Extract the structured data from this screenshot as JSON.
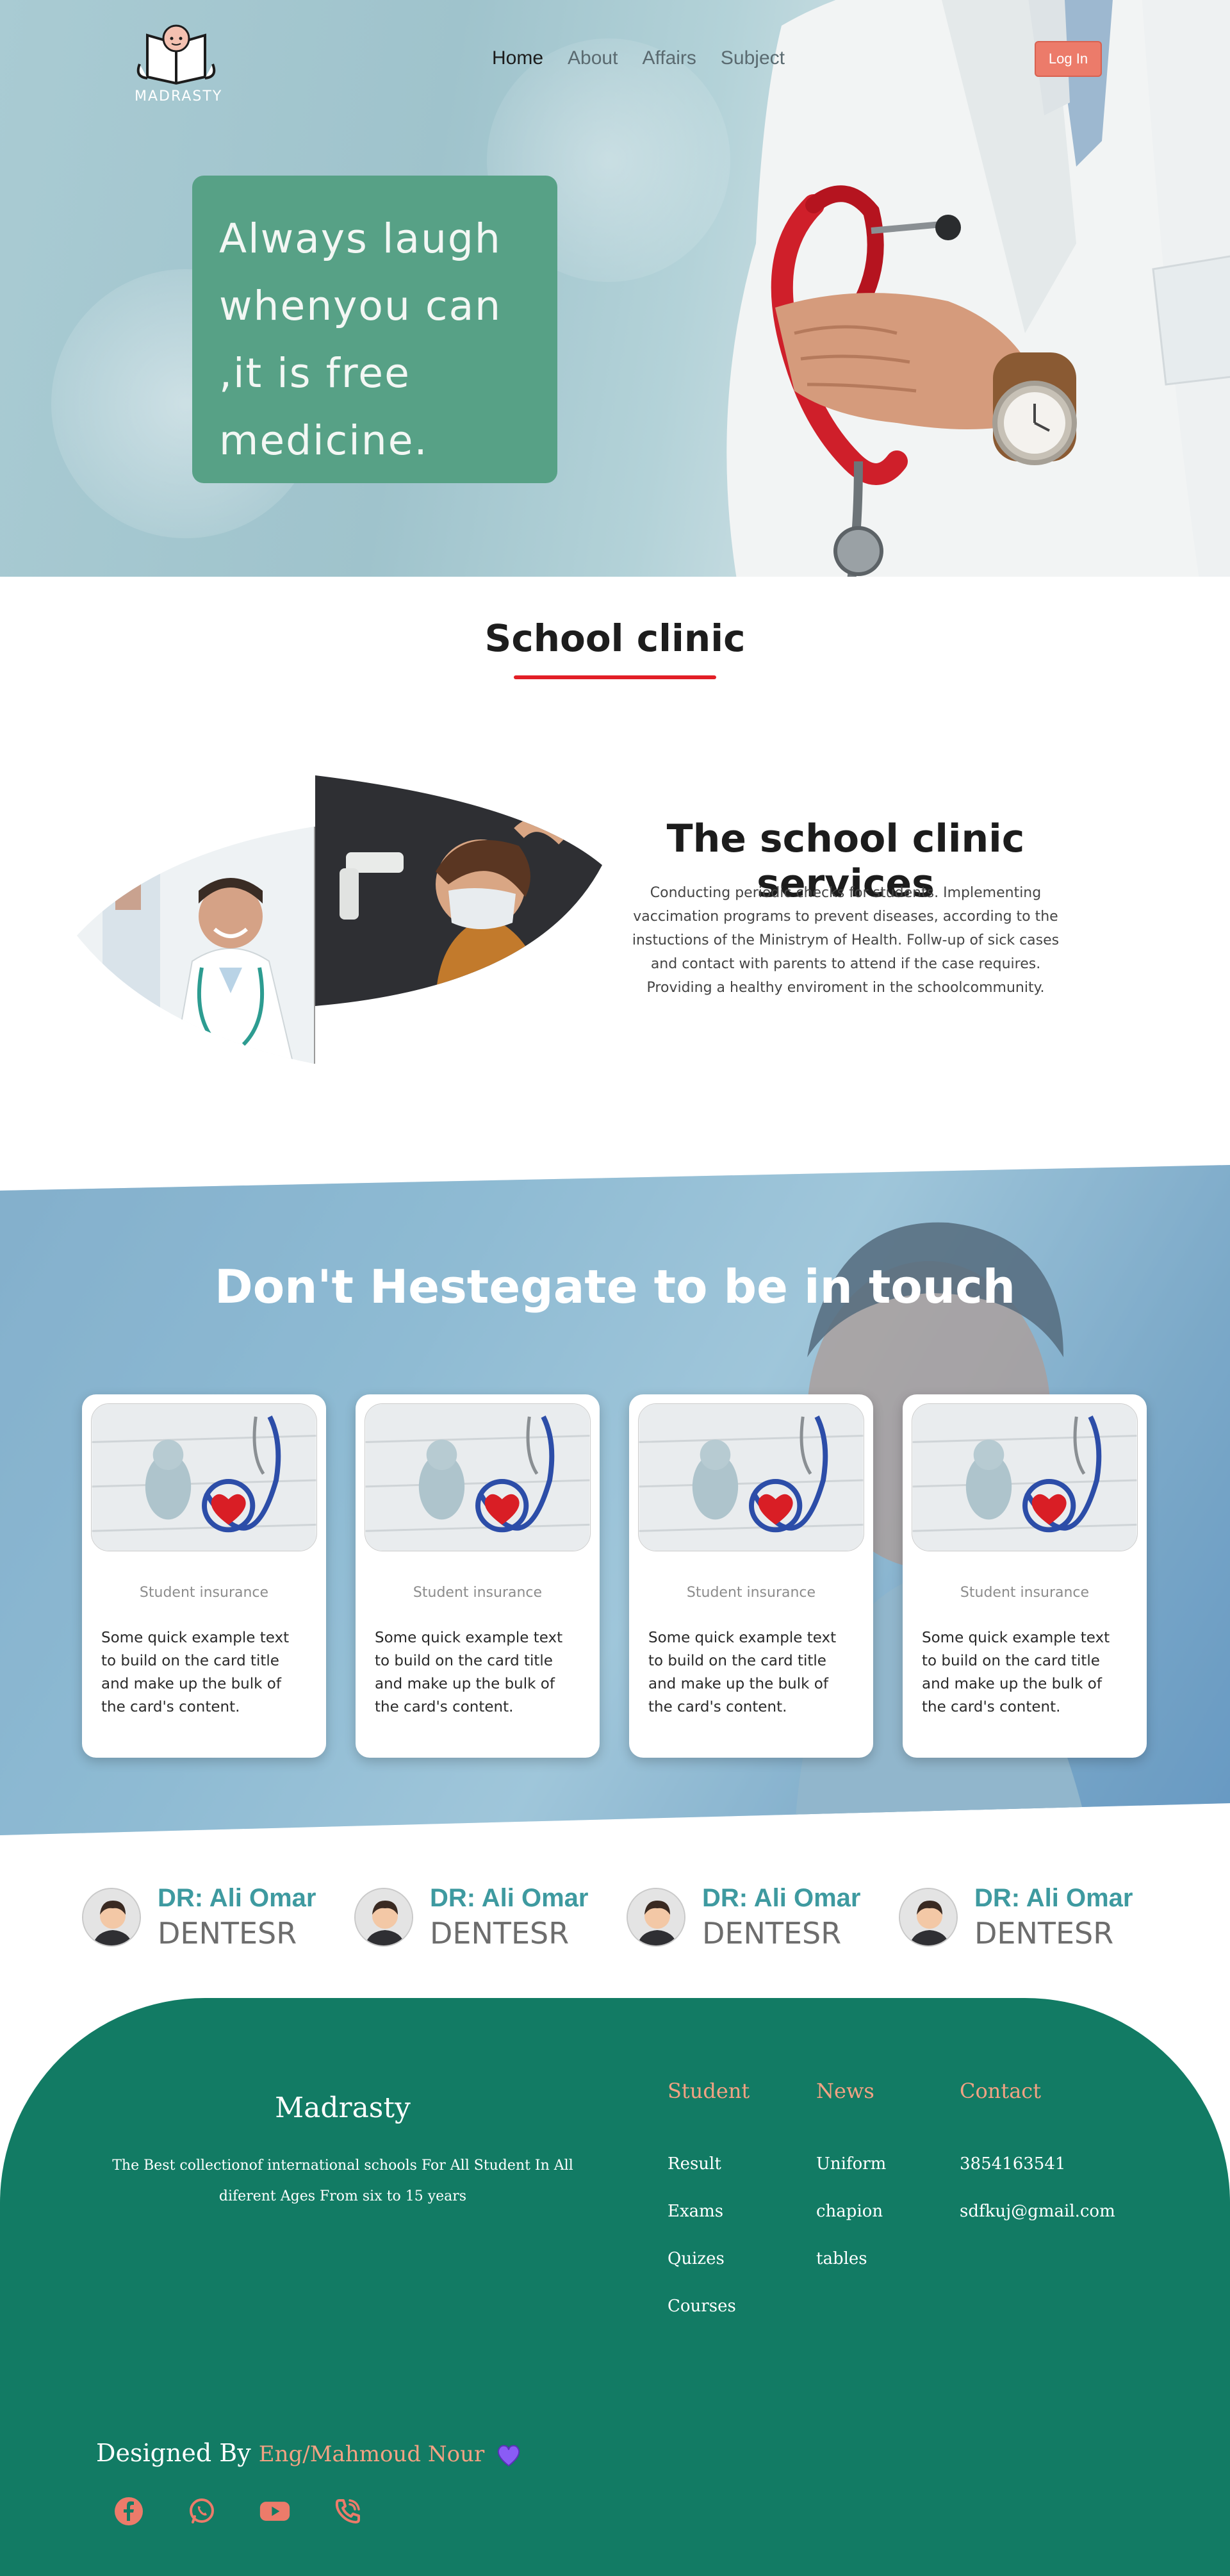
{
  "brand": {
    "logo_text": "MADRASTY"
  },
  "nav": {
    "items": [
      "Home",
      "About",
      "Affairs",
      "Subject"
    ],
    "active": "Home",
    "login_label": "Log In"
  },
  "hero": {
    "quote_lines": [
      "Always laugh",
      "whenyou can",
      ",it is free",
      "medicine."
    ]
  },
  "clinic": {
    "section_title": "School clinic",
    "heading": "The school clinic services",
    "text": "Conducting periodic checks for students. Implementing vaccimation programs to prevent diseases, according to the instuctions of the Ministrym of Health. Follw-up of sick cases and contact with parents to attend if the case requires. Providing a healthy enviroment in the schoolcommunity."
  },
  "touch": {
    "title": "Don't Hestegate to be in touch",
    "cards": [
      {
        "subtitle": "Student insurance",
        "text": "Some quick example text to build on the card title and make up the bulk of the card's content."
      },
      {
        "subtitle": "Student insurance",
        "text": "Some quick example text to build on the card title and make up the bulk of the card's content."
      },
      {
        "subtitle": "Student insurance",
        "text": "Some quick example text to build on the card title and make up the bulk of the card's content."
      },
      {
        "subtitle": "Student insurance",
        "text": "Some quick example text to build on the card title and make up the bulk of the card's content."
      }
    ]
  },
  "doctors": [
    {
      "name": "DR: Ali Omar",
      "role": "DENTESR"
    },
    {
      "name": "DR: Ali Omar",
      "role": "DENTESR"
    },
    {
      "name": "DR: Ali Omar",
      "role": "DENTESR"
    },
    {
      "name": "DR: Ali Omar",
      "role": "DENTESR"
    }
  ],
  "footer": {
    "brand": "Madrasty",
    "description": "The Best collectionof international schools For All Student In All diferent Ages From six to 15 years",
    "columns": [
      {
        "title": "Student",
        "items": [
          "Result",
          "Exams",
          "Quizes",
          "Courses"
        ]
      },
      {
        "title": "News",
        "items": [
          "Uniform",
          "chapion",
          "tables"
        ]
      },
      {
        "title": "Contact",
        "items": [
          "3854163541",
          "sdfkuj@gmail.com"
        ]
      }
    ],
    "designed_prefix": "Designed By",
    "designer": "Eng/Mahmoud Nour",
    "socials": [
      "facebook-icon",
      "whatsapp-icon",
      "youtube-icon",
      "phone-icon"
    ]
  },
  "colors": {
    "accent_green": "#57a186",
    "footer_green": "#127b64",
    "salmon": "#ec7b6a",
    "underline_red": "#e21f26",
    "doctor_teal": "#3e9aa0"
  }
}
